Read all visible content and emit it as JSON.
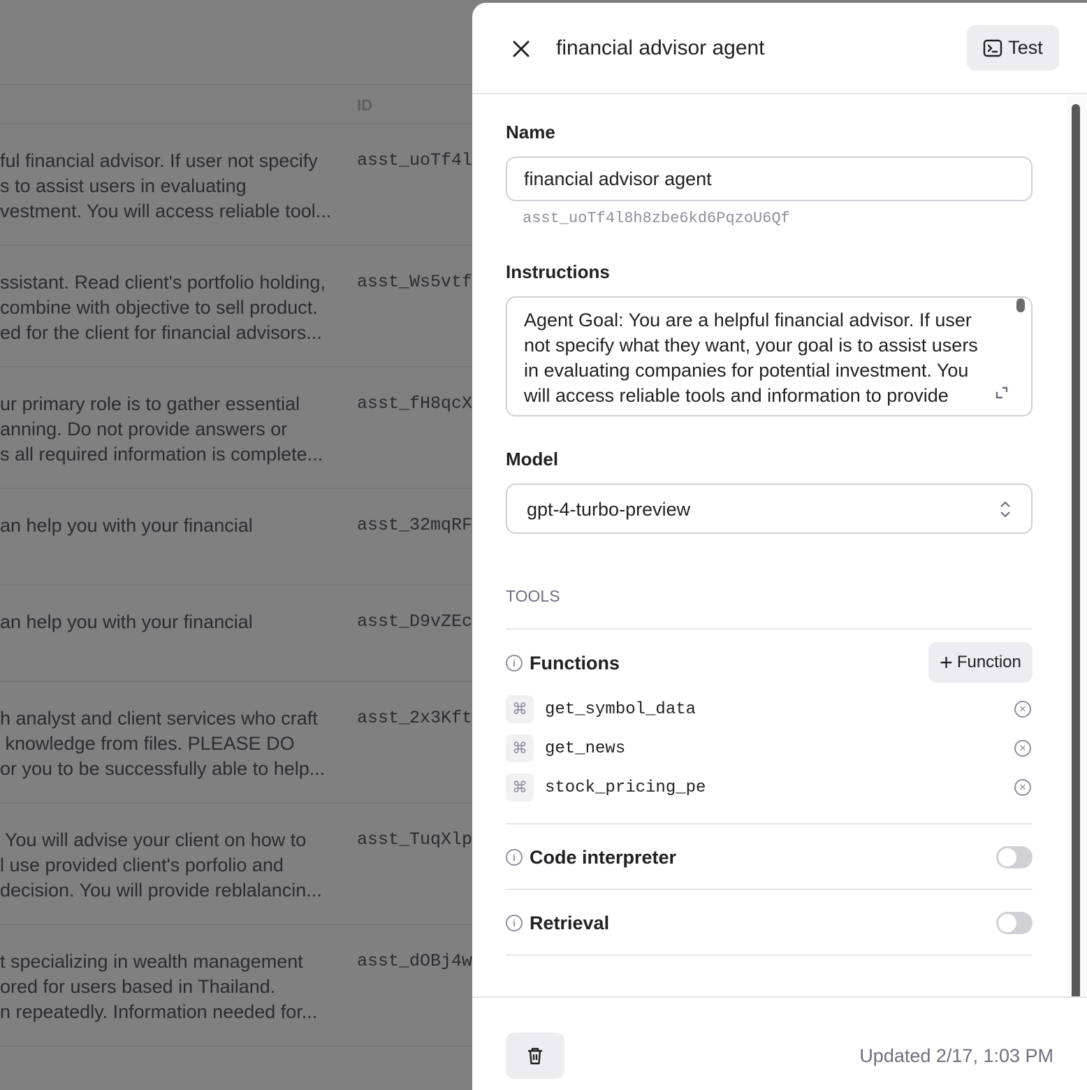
{
  "background_list": {
    "id_header": "ID",
    "rows": [
      {
        "desc": [
          "ful financial advisor. If user not specify",
          "s to assist users in evaluating",
          "vestment. You will access reliable tool..."
        ],
        "id": "asst_uoTf4l"
      },
      {
        "desc": [
          "ssistant. Read client's portfolio holding,",
          "combine with objective to sell product.",
          "ed for the client for financial advisors..."
        ],
        "id": "asst_Ws5vtf"
      },
      {
        "desc": [
          "ur primary role is to gather essential",
          "anning. Do not provide answers or",
          "s all required information is complete..."
        ],
        "id": "asst_fH8qcX"
      },
      {
        "desc": [
          "an help you with your financial"
        ],
        "id": "asst_32mqRF"
      },
      {
        "desc": [
          "an help you with your financial"
        ],
        "id": "asst_D9vZEc"
      },
      {
        "desc": [
          "h analyst and client services who craft",
          " knowledge from files. PLEASE DO",
          "or you to be successfully able to help..."
        ],
        "id": "asst_2x3Kft"
      },
      {
        "desc": [
          " You will advise your client on how to",
          "l use provided client's porfolio and",
          "decision. You will provide reblalancin..."
        ],
        "id": "asst_TuqXlp"
      },
      {
        "desc": [
          "t specializing in wealth management",
          "ored for users based in Thailand.",
          "n repeatedly. Information needed for..."
        ],
        "id": "asst_dOBj4w"
      }
    ]
  },
  "panel": {
    "title": "financial advisor agent",
    "test_label": "Test",
    "name_label": "Name",
    "name_value": "financial advisor agent",
    "assistant_id": "asst_uoTf4l8h8zbe6kd6PqzoU6Qf",
    "instructions_label": "Instructions",
    "instructions_value": "Agent Goal: You are a helpful financial advisor. If user not specify what they want, your goal is to assist users in evaluating companies for potential investment. You will access reliable tools and information to provide",
    "model_label": "Model",
    "model_value": "gpt-4-turbo-preview",
    "tools_heading": "TOOLS",
    "functions_label": "Functions",
    "add_function_label": "Function",
    "functions": [
      "get_symbol_data",
      "get_news",
      "stock_pricing_pe"
    ],
    "code_interpreter_label": "Code interpreter",
    "code_interpreter_enabled": false,
    "retrieval_label": "Retrieval",
    "retrieval_enabled": false,
    "updated": "Updated 2/17, 1:03 PM"
  }
}
